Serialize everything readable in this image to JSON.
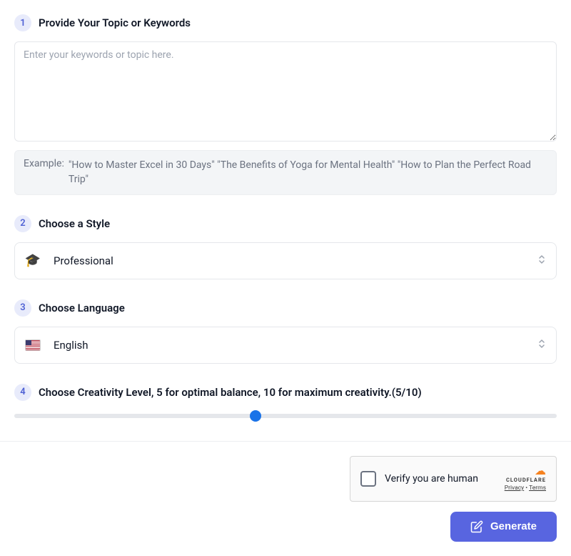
{
  "step1": {
    "number": "1",
    "title": "Provide Your Topic or Keywords",
    "placeholder": "Enter your keywords or topic here.",
    "exampleLabel": "Example:",
    "exampleText": "\"How to Master Excel in 30 Days\" \"The Benefits of Yoga for Mental Health\" \"How to Plan the Perfect Road Trip\""
  },
  "step2": {
    "number": "2",
    "title": "Choose a Style",
    "selected": "Professional",
    "icon": "🎓"
  },
  "step3": {
    "number": "3",
    "title": "Choose Language",
    "selected": "English"
  },
  "step4": {
    "number": "4",
    "title": "Choose Creativity Level, 5 for optimal balance, 10 for maximum creativity.(5/10)",
    "value": 5,
    "min": 1,
    "max": 10
  },
  "captcha": {
    "text": "Verify you are human",
    "brand": "CLOUDFLARE",
    "privacy": "Privacy",
    "terms": "Terms",
    "sep": " • "
  },
  "action": {
    "generate": "Generate"
  }
}
